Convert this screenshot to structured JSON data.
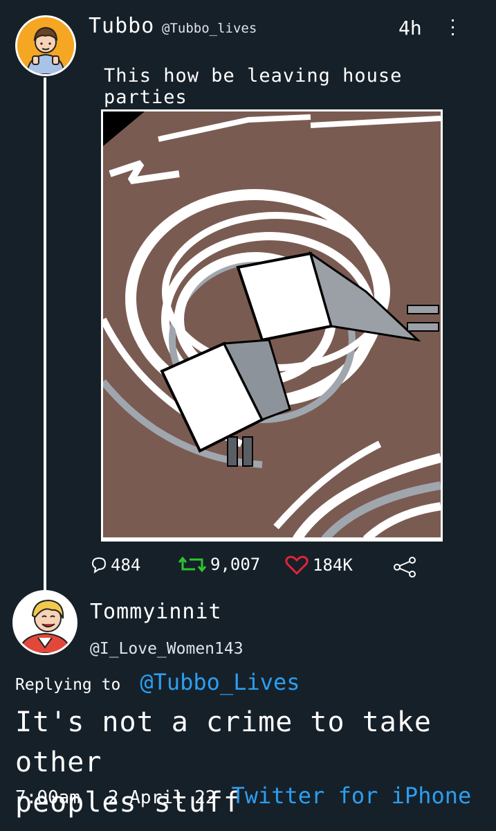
{
  "tweet": {
    "display_name": "Tubbo",
    "handle": "@Tubbo_lives",
    "time_ago": "4h",
    "more_icon": "vertical-dots-icon",
    "text": "This how be leaving house parties",
    "image_alt_icon": "tangled-charger-cable-drawing",
    "stats": {
      "replies": "484",
      "retweets": "9,007",
      "likes": "184K"
    },
    "colors": {
      "retweet": "#2ec52e",
      "like": "#e0243a"
    }
  },
  "reply": {
    "display_name": "Tommyinnit",
    "handle": "@I_Love_Women143",
    "replying_label": "Replying to",
    "replying_mention": "@Tubbo_Lives",
    "text_line1": "It's not a crime to take other",
    "text_line2": "peoples stuff",
    "time": "7:00am",
    "date": "2 April 22",
    "source": "Twitter for iPhone"
  },
  "theme": {
    "background": "#162029",
    "link": "#2c9ef0"
  }
}
